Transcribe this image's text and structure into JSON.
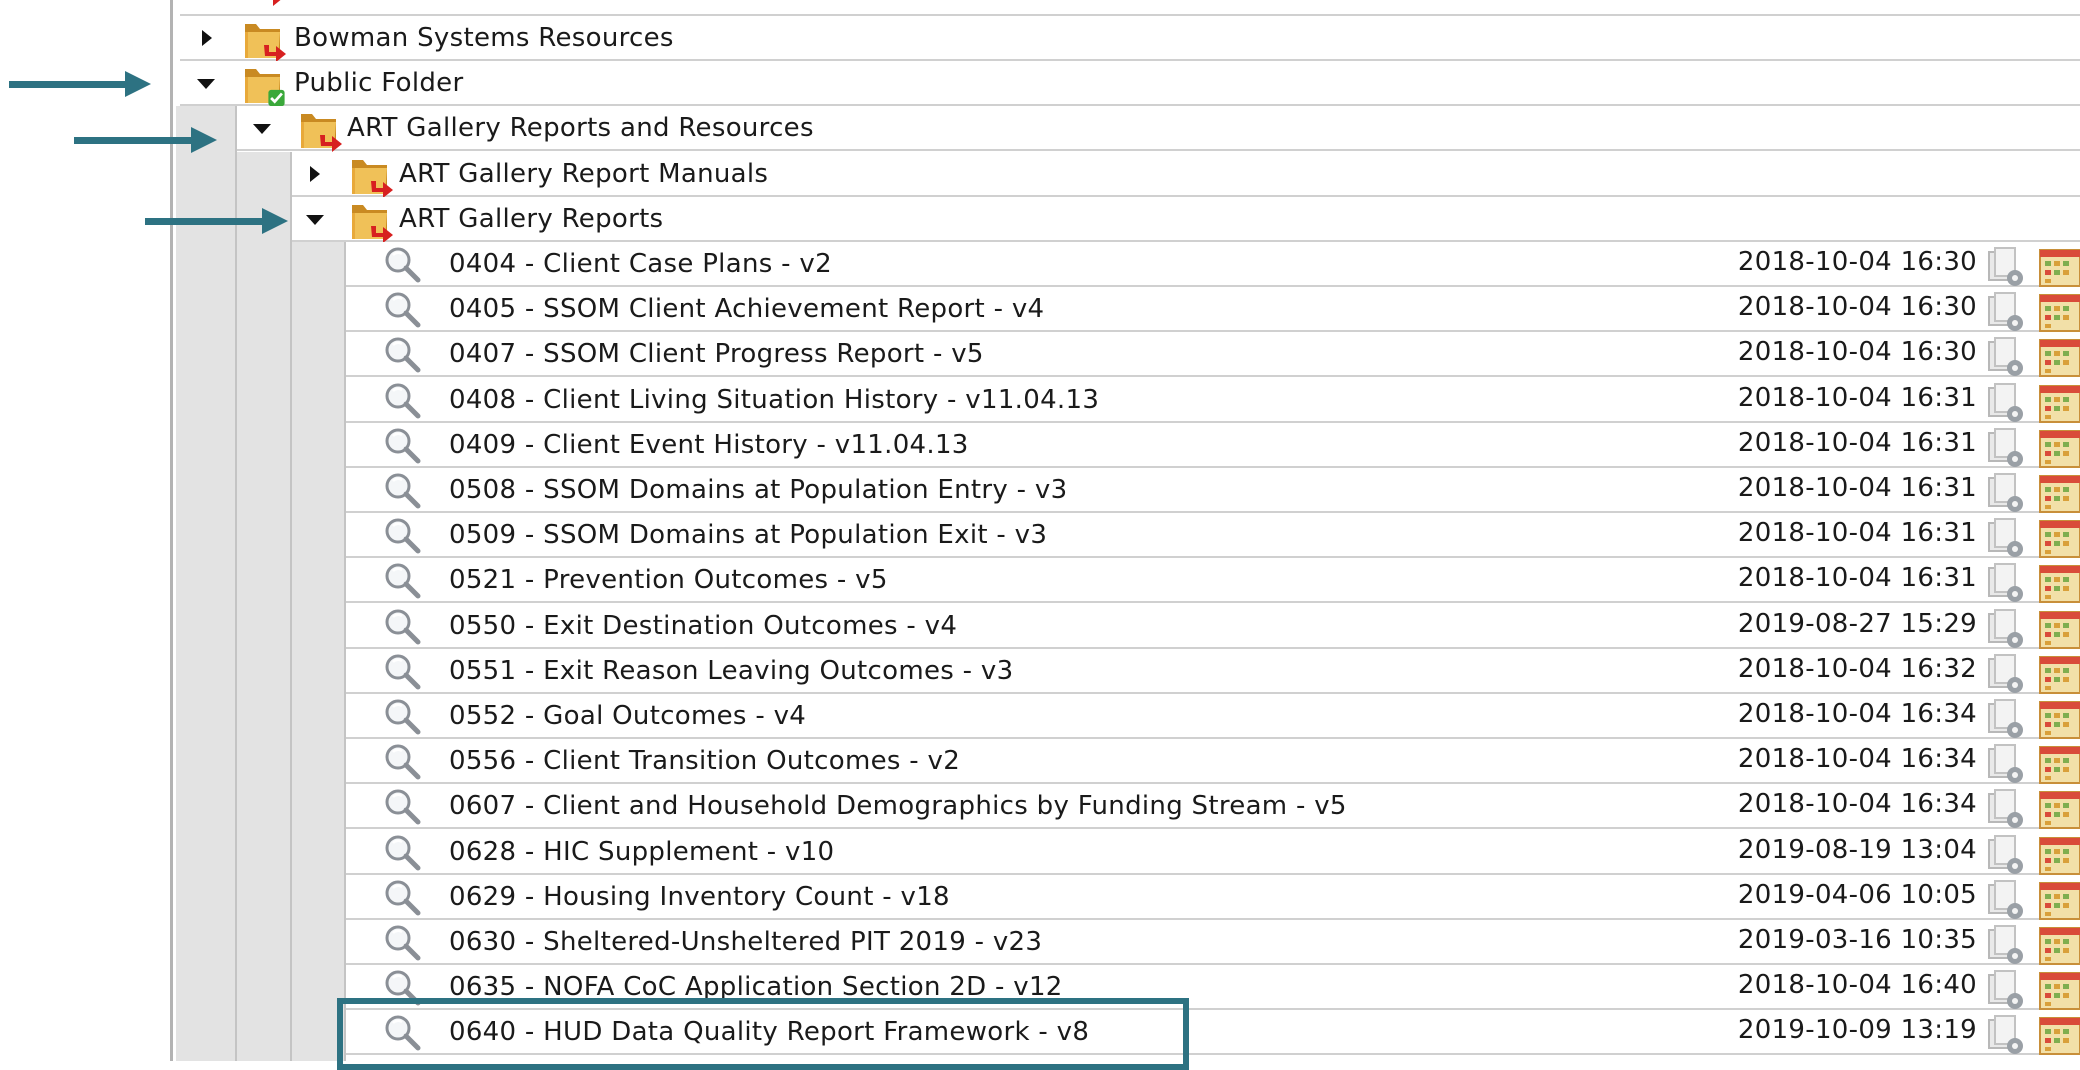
{
  "tree": {
    "bowman_folder": {
      "label": "Bowman Systems Resources"
    },
    "public_folder": {
      "label": "Public Folder"
    },
    "art_gallery_reports_and_resources": {
      "label": "ART Gallery Reports and Resources"
    },
    "art_gallery_report_manuals": {
      "label": "ART Gallery Report Manuals"
    },
    "art_gallery_reports": {
      "label": "ART Gallery Reports"
    }
  },
  "reports": [
    {
      "label": "0404 - Client Case Plans - v2",
      "timestamp": "2018-10-04 16:30"
    },
    {
      "label": "0405 - SSOM Client Achievement Report - v4",
      "timestamp": "2018-10-04 16:30"
    },
    {
      "label": "0407 - SSOM Client Progress Report - v5",
      "timestamp": "2018-10-04 16:30"
    },
    {
      "label": "0408 - Client Living Situation History - v11.04.13",
      "timestamp": "2018-10-04 16:31"
    },
    {
      "label": "0409 - Client Event History - v11.04.13",
      "timestamp": "2018-10-04 16:31"
    },
    {
      "label": "0508 - SSOM Domains at Population Entry - v3",
      "timestamp": "2018-10-04 16:31"
    },
    {
      "label": "0509 - SSOM Domains at Population Exit - v3",
      "timestamp": "2018-10-04 16:31"
    },
    {
      "label": "0521 - Prevention Outcomes - v5",
      "timestamp": "2018-10-04 16:31"
    },
    {
      "label": "0550 - Exit Destination Outcomes - v4",
      "timestamp": "2019-08-27 15:29"
    },
    {
      "label": "0551 - Exit Reason Leaving Outcomes - v3",
      "timestamp": "2018-10-04 16:32"
    },
    {
      "label": "0552 - Goal Outcomes - v4",
      "timestamp": "2018-10-04 16:34"
    },
    {
      "label": "0556 - Client Transition Outcomes - v2",
      "timestamp": "2018-10-04 16:34"
    },
    {
      "label": "0607 - Client and Household Demographics by Funding Stream - v5",
      "timestamp": "2018-10-04 16:34"
    },
    {
      "label": "0628 - HIC Supplement - v10",
      "timestamp": "2019-08-19 13:04"
    },
    {
      "label": "0629 - Housing Inventory Count - v18",
      "timestamp": "2019-04-06 10:05"
    },
    {
      "label": "0630 - Sheltered-Unsheltered PIT 2019 - v23",
      "timestamp": "2019-03-16 10:35"
    },
    {
      "label": "0635 - NOFA CoC Application Section 2D - v12",
      "timestamp": "2018-10-04 16:40"
    },
    {
      "label": "0640 - HUD Data Quality Report Framework - v8",
      "timestamp": "2019-10-09 13:19"
    }
  ],
  "icons": {
    "toggle_collapsed": "triangle-right-icon",
    "toggle_expanded": "triangle-down-icon",
    "folder": "folder-icon",
    "folder_link_arrow": "red-arrow-overlay",
    "folder_shared_check": "green-check-overlay",
    "report_view": "magnifier-icon",
    "report_properties": "report-properties-icon",
    "report_schedule": "report-schedule-icon"
  },
  "colors": {
    "annotation": "#2d7282",
    "folder": "#e8b64a",
    "link_arrow": "#d72020",
    "check": "#3aa83a",
    "gutter": "#e3e3e3"
  }
}
